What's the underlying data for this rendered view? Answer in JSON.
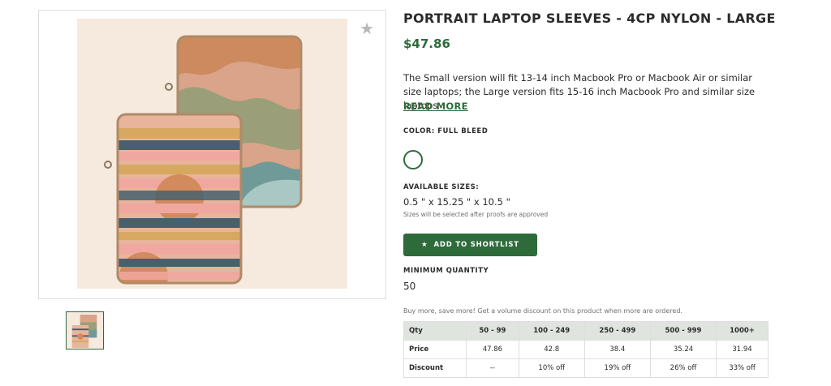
{
  "product": {
    "title": "PORTRAIT LAPTOP SLEEVES - 4CP NYLON - LARGE",
    "price": "$47.86",
    "description": "The Small version will fit 13-14 inch Macbook Pro or Macbook Air or similar size laptops; the Large version fits 15-16 inch Macbook Pro and similar size laptops",
    "read_more": "READ MORE",
    "color_label": "COLOR: FULL BLEED",
    "sizes_label": "AVAILABLE SIZES:",
    "size_value": "0.5 \" x 15.25 \" x 10.5 \"",
    "size_note": "Sizes will be selected after proofs are approved",
    "shortlist_label": "ADD TO SHORTLIST",
    "min_qty_label": "MINIMUM QUANTITY",
    "min_qty": "50",
    "volume_note": "Buy more, save more! Get a volume discount on this product when more are ordered."
  },
  "pricing": {
    "headers": [
      "Qty",
      "50 - 99",
      "100 - 249",
      "250 - 499",
      "500 - 999",
      "1000+"
    ],
    "rows": [
      [
        "Price",
        "47.86",
        "42.8",
        "38.4",
        "35.24",
        "31.94"
      ],
      [
        "Discount",
        "--",
        "10% off",
        "19% off",
        "26% off",
        "33% off"
      ]
    ]
  },
  "colors": {
    "accent": "#2e6b3a",
    "table_header": "#dfe4df"
  },
  "icons": {
    "favorite": "star-icon",
    "shortlist": "star-icon"
  }
}
